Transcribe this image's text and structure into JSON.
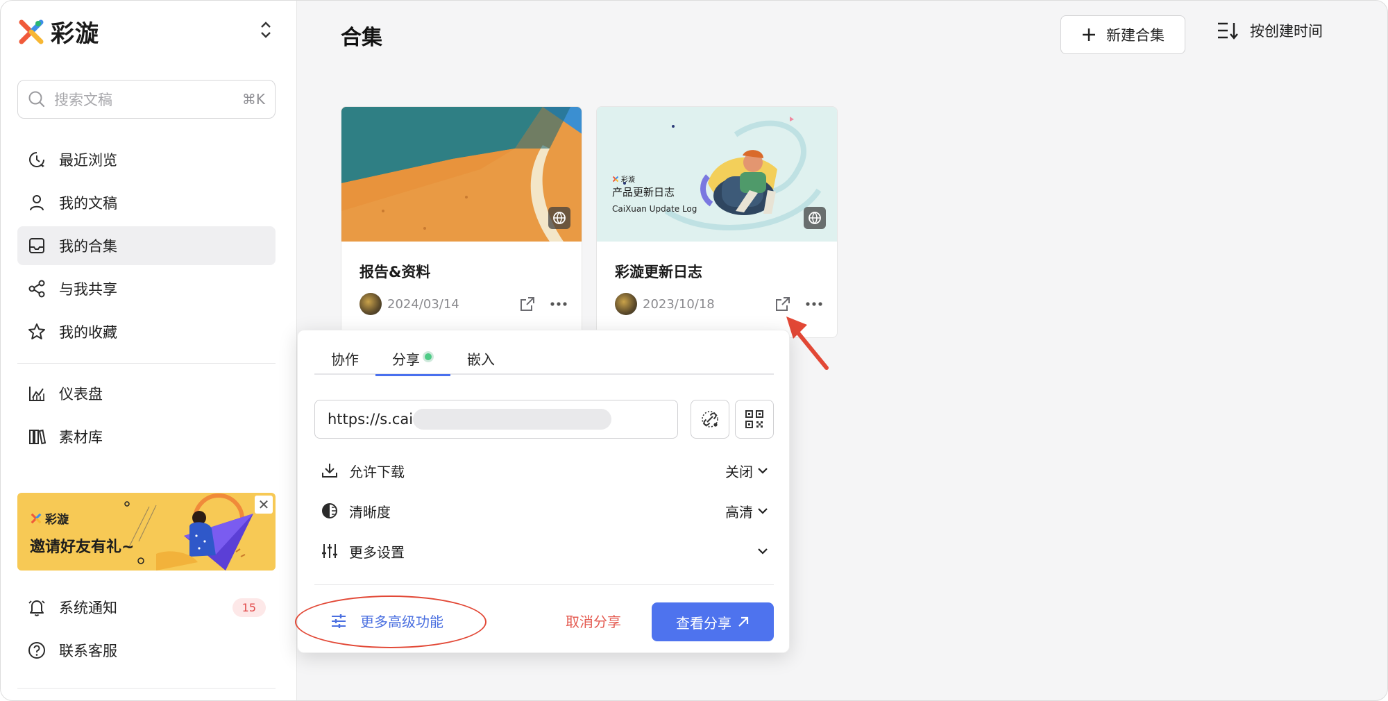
{
  "app": {
    "logo_text": "彩漩",
    "brand_colors": [
      "#f05a3a",
      "#2bb673",
      "#3e8ee8",
      "#f7b733"
    ]
  },
  "search": {
    "placeholder": "搜索文稿",
    "shortcut": "⌘K"
  },
  "sidebar": {
    "items": [
      {
        "label": "最近浏览",
        "icon": "clock-icon",
        "active": false
      },
      {
        "label": "我的文稿",
        "icon": "user-icon",
        "active": false
      },
      {
        "label": "我的合集",
        "icon": "inbox-icon",
        "active": true
      },
      {
        "label": "与我共享",
        "icon": "share-nodes-icon",
        "active": false
      },
      {
        "label": "我的收藏",
        "icon": "star-icon",
        "active": false
      }
    ],
    "tools": [
      {
        "label": "仪表盘",
        "icon": "chart-icon"
      },
      {
        "label": "素材库",
        "icon": "books-icon"
      }
    ],
    "promo": {
      "brand": "彩漩",
      "title": "邀请好友有礼~"
    },
    "bottom": [
      {
        "label": "系统通知",
        "icon": "bell-icon",
        "badge": "15"
      },
      {
        "label": "联系客服",
        "icon": "help-icon"
      }
    ]
  },
  "main": {
    "title": "合集",
    "new_button": "新建合集",
    "sort_label": "按创建时间"
  },
  "cards": [
    {
      "title": "报告&资料",
      "date": "2024/03/14"
    },
    {
      "title": "彩漩更新日志",
      "date": "2023/10/18",
      "thumb_brand": "彩漩",
      "thumb_title": "产品更新日志",
      "thumb_subtitle": "CaiXuan Update Log"
    }
  ],
  "share_popup": {
    "tabs": [
      "协作",
      "分享",
      "嵌入"
    ],
    "active_tab": "分享",
    "url": "https://s.cai",
    "options": [
      {
        "label": "允许下载",
        "value": "关闭",
        "icon": "download-icon"
      },
      {
        "label": "清晰度",
        "value": "高清",
        "icon": "contrast-icon"
      },
      {
        "label": "更多设置",
        "value": "",
        "icon": "sliders-icon"
      }
    ],
    "advanced_label": "更多高级功能",
    "cancel_label": "取消分享",
    "view_label": "查看分享"
  },
  "annotation_color": "#e24836"
}
